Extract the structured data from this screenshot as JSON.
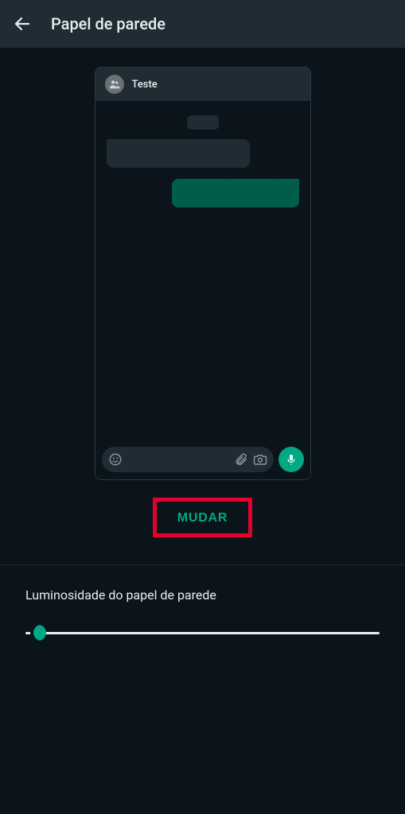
{
  "header": {
    "title": "Papel de parede"
  },
  "preview": {
    "contact_name": "Teste"
  },
  "actions": {
    "change_label": "MUDAR"
  },
  "brightness": {
    "label": "Luminosidade do papel de parede",
    "value_percent": 3
  },
  "colors": {
    "accent": "#00a884",
    "highlight_border": "#e4002b",
    "bubble_out": "#005c4b",
    "surface": "#1f2c34",
    "background": "#0b141a"
  }
}
